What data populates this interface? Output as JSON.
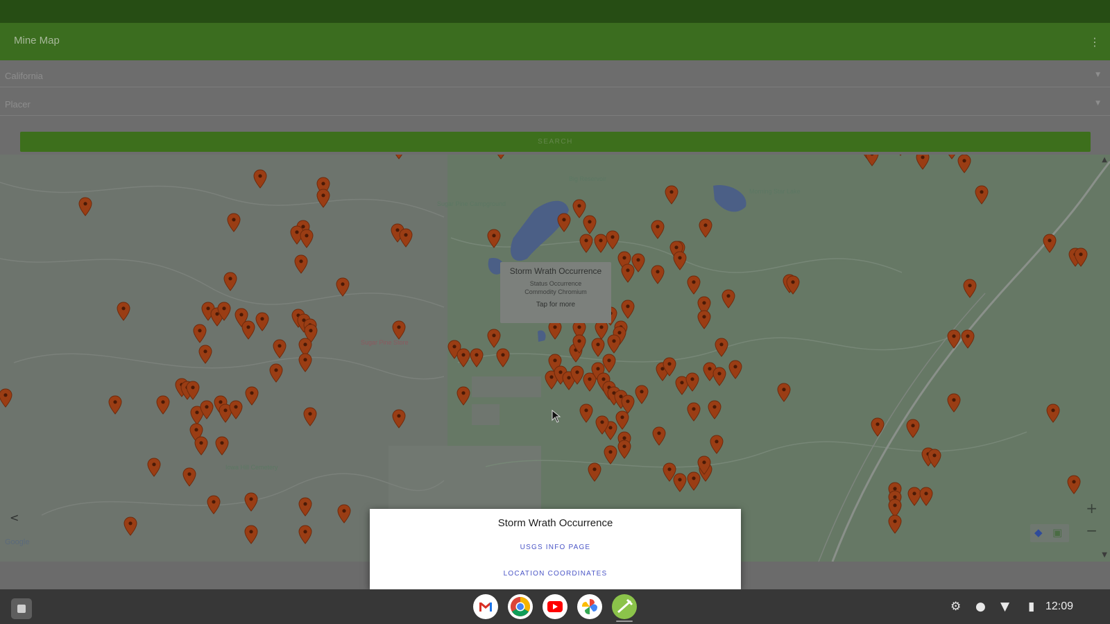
{
  "app": {
    "title": "Mine Map",
    "overflow_icon": "more-vert-icon"
  },
  "form": {
    "state": "California",
    "county": "Placer",
    "search_label": "SEARCH"
  },
  "map": {
    "info_window": {
      "title": "Storm Wrath Occurrence",
      "status": "Status Occurrence",
      "commodity": "Commodity Chromium",
      "more": "Tap for more"
    },
    "zoom_in": "+",
    "zoom_out": "−",
    "attribution": "Google"
  },
  "dialog": {
    "title": "Storm Wrath Occurrence",
    "option_1": "USGS INFO PAGE",
    "option_2": "LOCATION COORDINATES"
  },
  "shelf": {
    "apps": [
      "gmail-icon",
      "chrome-icon",
      "youtube-icon",
      "photos-icon",
      "mine-map-app-icon"
    ],
    "time": "12:09"
  },
  "colors": {
    "accent_green": "#3b6d1f",
    "marker": "#9a3d14",
    "dialog_link": "#4a55c6"
  }
}
